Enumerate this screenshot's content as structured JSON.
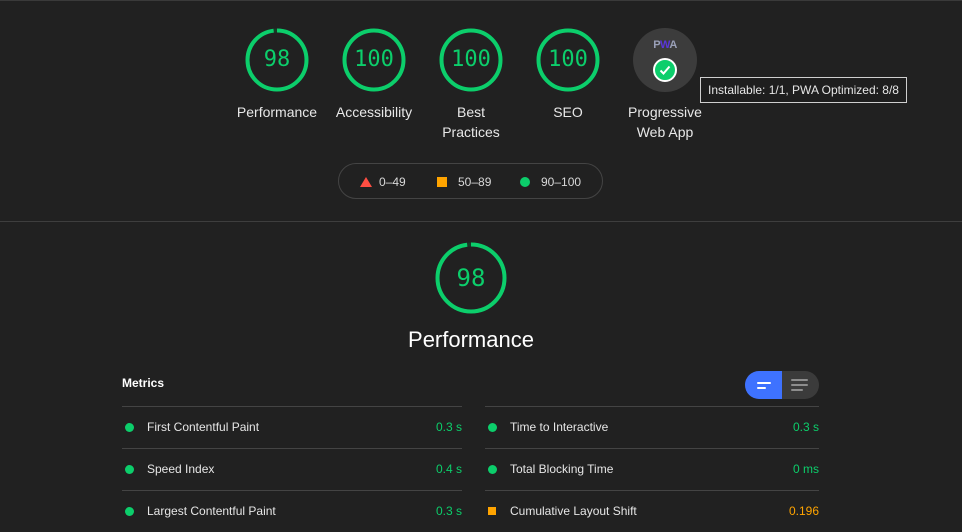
{
  "categories": [
    {
      "label": "Performance",
      "score": "98",
      "fraction": 0.98
    },
    {
      "label": "Accessibility",
      "score": "100",
      "fraction": 1.0
    },
    {
      "label": "Best\nPractices",
      "score": "100",
      "fraction": 1.0
    },
    {
      "label": "SEO",
      "score": "100",
      "fraction": 1.0
    }
  ],
  "pwa": {
    "badge_text": "PWA",
    "label": "Progressive\nWeb App",
    "tooltip": "Installable: 1/1, PWA Optimized: 8/8"
  },
  "legend": {
    "fail": "0–49",
    "average": "50–89",
    "pass": "90–100"
  },
  "performance": {
    "score": "98",
    "fraction": 0.98,
    "title": "Performance"
  },
  "metrics": {
    "title": "Metrics",
    "left": [
      {
        "name": "First Contentful Paint",
        "value": "0.3 s",
        "status": "pass"
      },
      {
        "name": "Speed Index",
        "value": "0.4 s",
        "status": "pass"
      },
      {
        "name": "Largest Contentful Paint",
        "value": "0.3 s",
        "status": "pass"
      }
    ],
    "right": [
      {
        "name": "Time to Interactive",
        "value": "0.3 s",
        "status": "pass"
      },
      {
        "name": "Total Blocking Time",
        "value": "0 ms",
        "status": "pass"
      },
      {
        "name": "Cumulative Layout Shift",
        "value": "0.196",
        "status": "average"
      }
    ]
  },
  "colors": {
    "pass": "#0cce6b",
    "average": "#ffa400",
    "fail": "#ff4e42",
    "accent": "#3e72ff"
  }
}
